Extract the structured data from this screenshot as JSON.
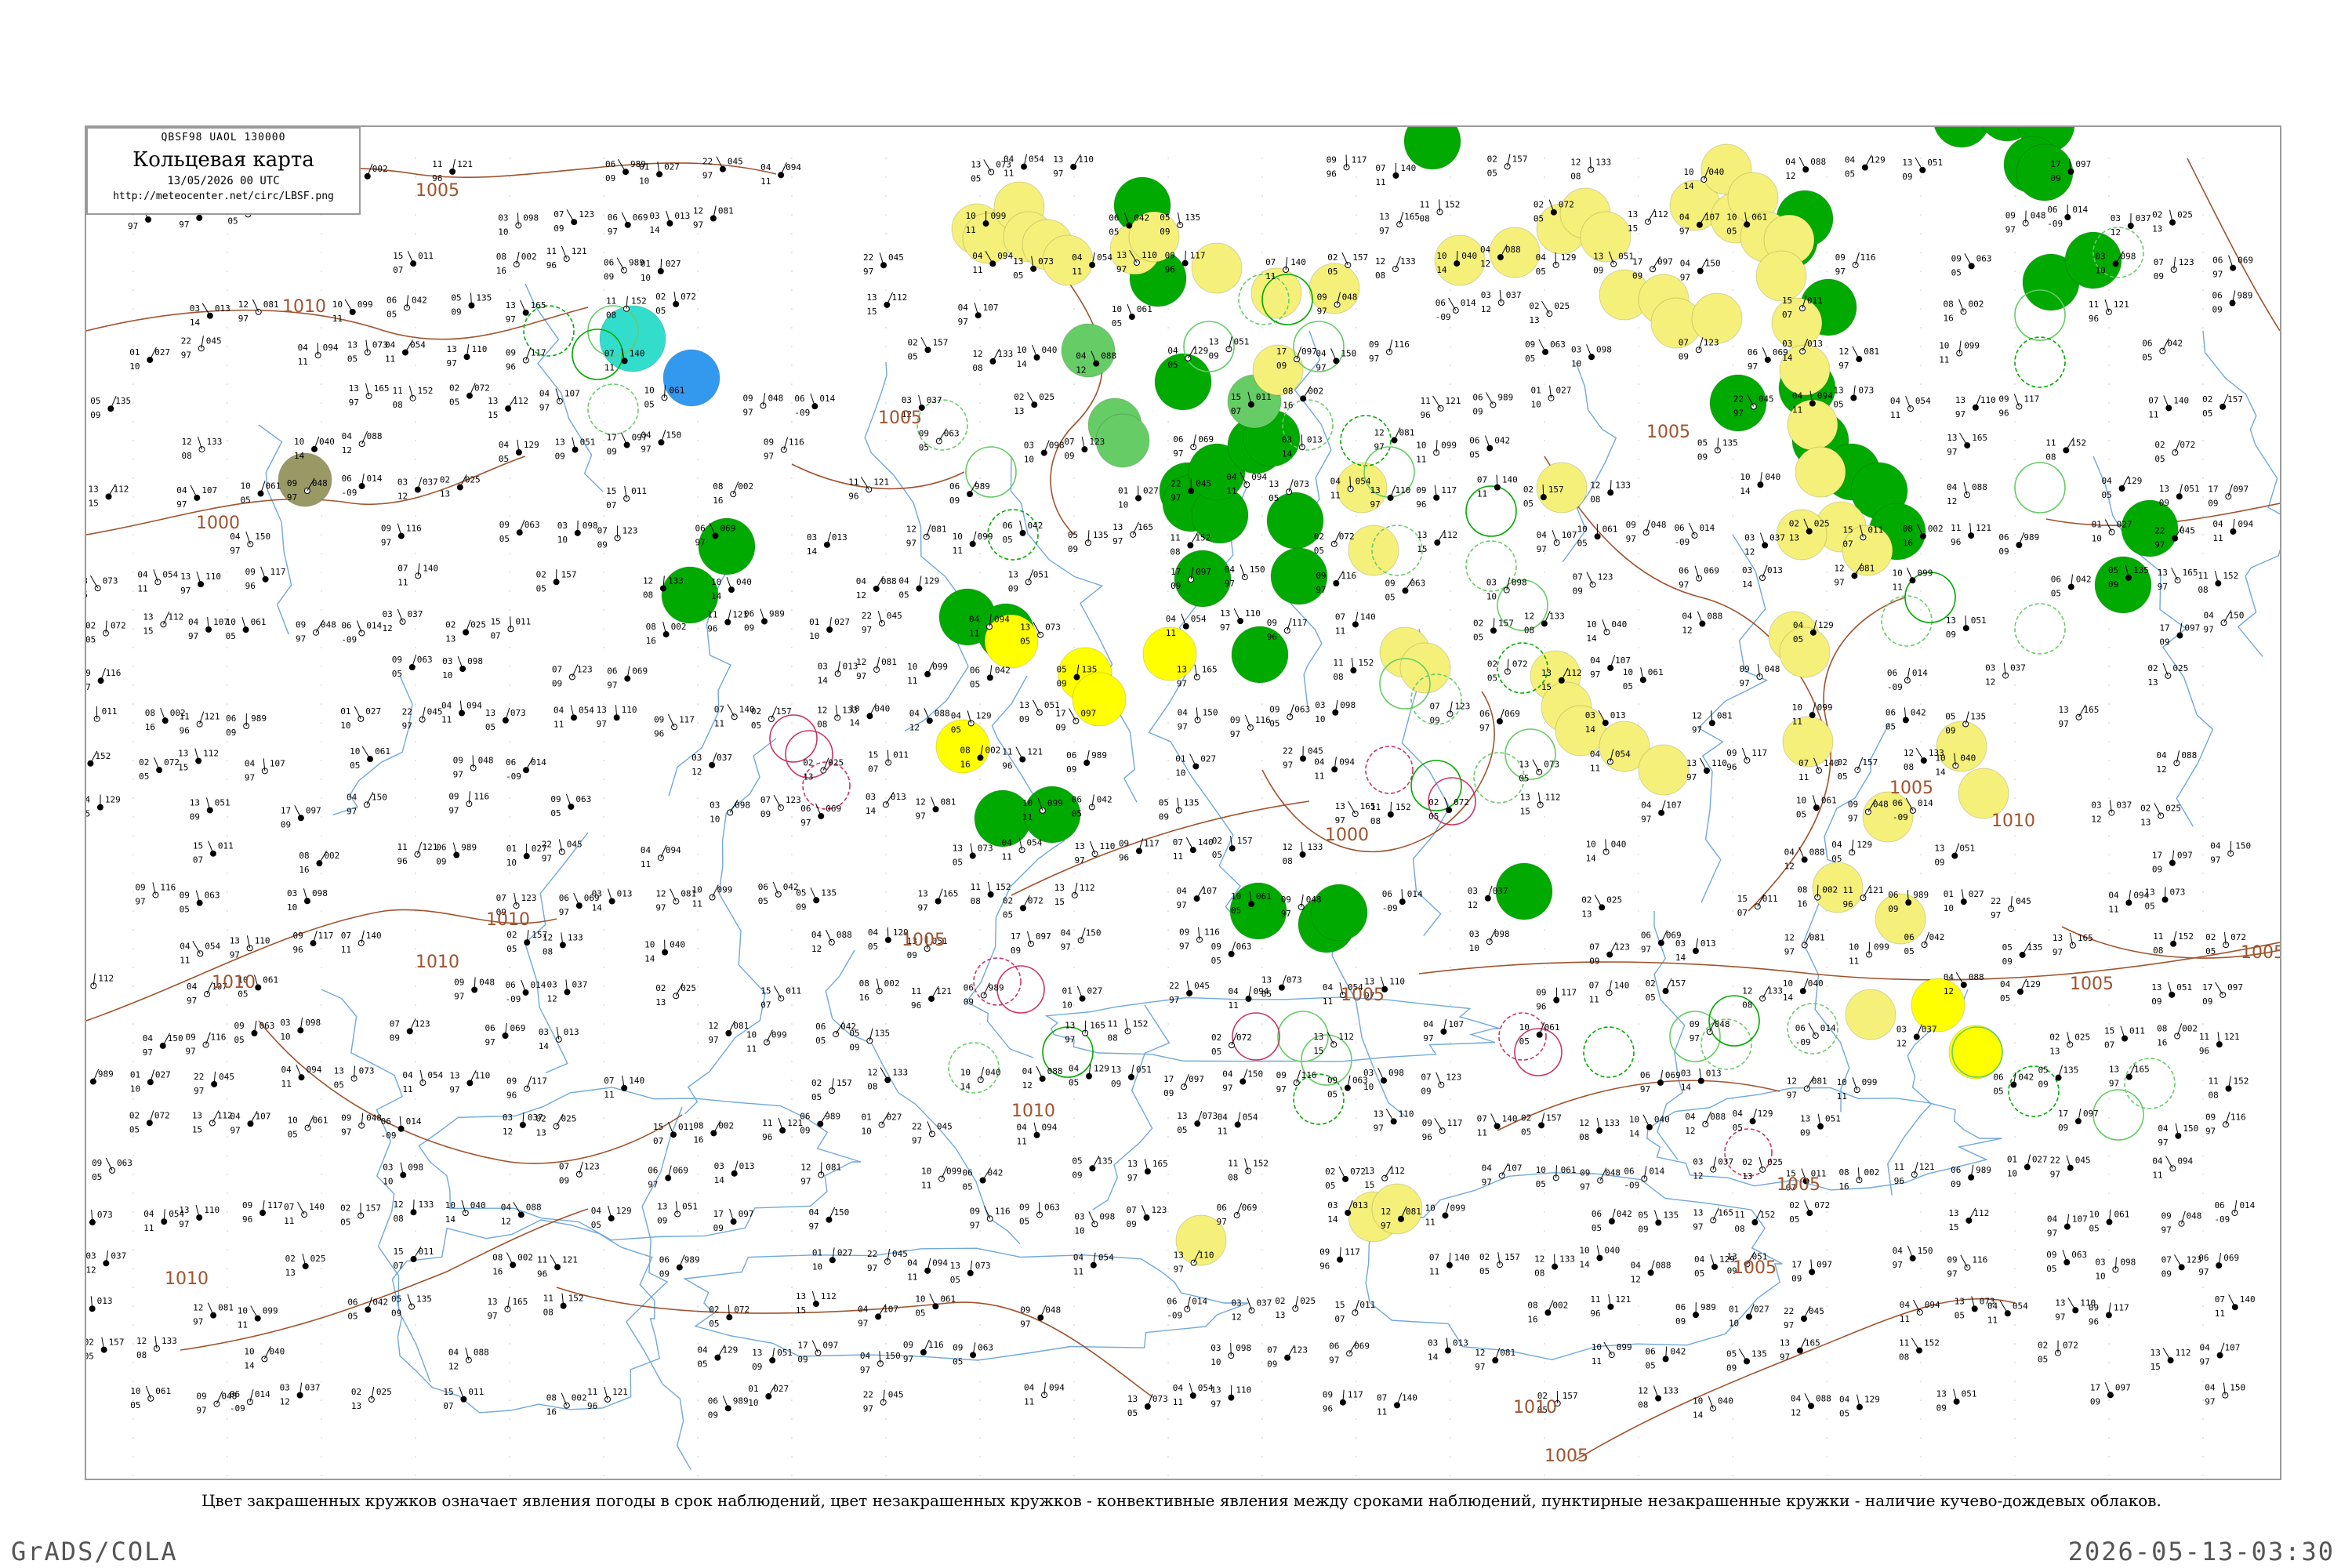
{
  "header": {
    "codes": "QBSF98  UAOL  130000",
    "title": "Кольцевая карта",
    "datetime": "13/05/2026 00 UTC",
    "url": "http://meteocenter.net/circ/LBSF.png"
  },
  "caption": "Цвет закрашенных кружков означает явления погоды в срок наблюдений, цвет незакрашенных кружков - конвективные явления между сроками наблюдений, пунктирные незакрашенные кружки - наличие кучево-дождевых облаков.",
  "footer": {
    "left": "GrADS/COLA",
    "right": "2026-05-13-03:30"
  },
  "colors": {
    "isobar": "#a0522d",
    "rivers": "#6fa8dc",
    "rain": "#00aa00",
    "rain_light": "#66cc66",
    "fog_haze": "#f5f07a",
    "dust": "#ffff00",
    "snow": "#3399ee",
    "cyan": "#33ddcc",
    "thunder_ring": "#cc3366",
    "olive": "#999966"
  },
  "isobar_labels": [
    "1005",
    "1010",
    "1000",
    "1005",
    "1010",
    "1010",
    "1010",
    "1005",
    "1000",
    "1005",
    "1005",
    "1005",
    "1010",
    "1005",
    "1005",
    "1005",
    "1010",
    "1005",
    "1010",
    "1010",
    "1005"
  ],
  "stations": [
    {
      "p": "014",
      "t": "-09",
      "d": "06"
    },
    {
      "p": "037",
      "t": "12",
      "d": "03"
    },
    {
      "p": "025",
      "t": "13",
      "d": "02"
    },
    {
      "p": "011",
      "t": "07",
      "d": "15"
    },
    {
      "p": "002",
      "t": "16",
      "d": "08"
    },
    {
      "p": "121",
      "t": "96",
      "d": "11"
    },
    {
      "p": "989",
      "t": "09",
      "d": "06"
    },
    {
      "p": "027",
      "t": "10",
      "d": "01"
    },
    {
      "p": "045",
      "t": "97",
      "d": "22"
    },
    {
      "p": "094",
      "t": "11",
      "d": "04"
    },
    {
      "p": "073",
      "t": "05",
      "d": "13"
    },
    {
      "p": "054",
      "t": "11",
      "d": "04"
    },
    {
      "p": "110",
      "t": "97",
      "d": "13"
    },
    {
      "p": "117",
      "t": "96",
      "d": "09"
    },
    {
      "p": "140",
      "t": "11",
      "d": "07"
    },
    {
      "p": "157",
      "t": "05",
      "d": "02"
    },
    {
      "p": "133",
      "t": "08",
      "d": "12"
    },
    {
      "p": "040",
      "t": "14",
      "d": "10"
    },
    {
      "p": "088",
      "t": "12",
      "d": "04"
    },
    {
      "p": "129",
      "t": "05",
      "d": "04"
    },
    {
      "p": "051",
      "t": "09",
      "d": "13"
    },
    {
      "p": "097",
      "t": "09",
      "d": "17"
    },
    {
      "p": "150",
      "t": "97",
      "d": "04"
    },
    {
      "p": "116",
      "t": "97",
      "d": "09"
    },
    {
      "p": "063",
      "t": "05",
      "d": "09"
    },
    {
      "p": "098",
      "t": "10",
      "d": "03"
    },
    {
      "p": "123",
      "t": "09",
      "d": "07"
    },
    {
      "p": "069",
      "t": "97",
      "d": "06"
    },
    {
      "p": "013",
      "t": "14",
      "d": "03"
    },
    {
      "p": "081",
      "t": "97",
      "d": "12"
    },
    {
      "p": "099",
      "t": "11",
      "d": "10"
    },
    {
      "p": "042",
      "t": "05",
      "d": "06"
    },
    {
      "p": "135",
      "t": "09",
      "d": "05"
    },
    {
      "p": "165",
      "t": "97",
      "d": "13"
    },
    {
      "p": "152",
      "t": "08",
      "d": "11"
    },
    {
      "p": "072",
      "t": "05",
      "d": "02"
    },
    {
      "p": "112",
      "t": "15",
      "d": "13"
    },
    {
      "p": "107",
      "t": "97",
      "d": "04"
    },
    {
      "p": "061",
      "t": "05",
      "d": "10"
    },
    {
      "p": "048",
      "t": "97",
      "d": "09"
    }
  ]
}
